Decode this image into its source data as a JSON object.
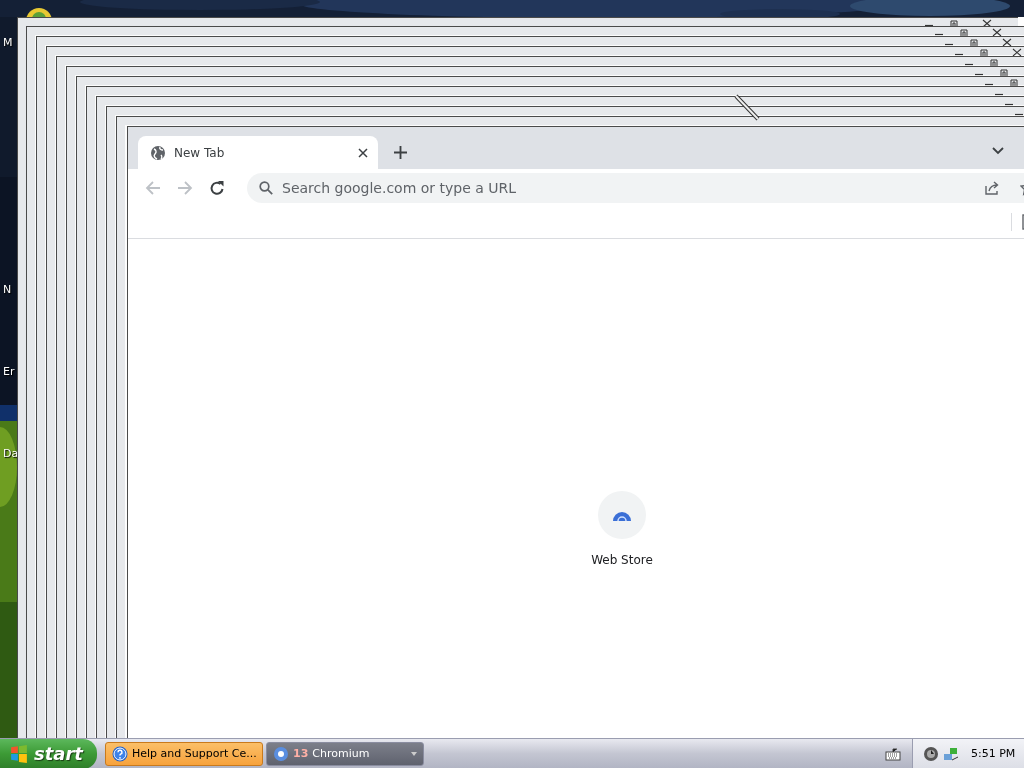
{
  "desktop": {
    "icons": [
      {
        "label": "M"
      },
      {
        "label": "N"
      },
      {
        "label": "Er"
      },
      {
        "label": "Da"
      }
    ]
  },
  "browser": {
    "tabs": [
      {
        "title": "New Tab",
        "selected": true
      }
    ],
    "omnibox": {
      "placeholder": "Search google.com or type a URL"
    },
    "shortcuts": [
      {
        "label": "Web Store"
      }
    ]
  },
  "taskbar": {
    "start": "start",
    "tasks": [
      {
        "kind": "window",
        "label": "Help and Support Ce...",
        "highlighted": true
      },
      {
        "kind": "group",
        "count": "13",
        "label": "Chromium",
        "highlighted": false
      }
    ],
    "clock": "5:51 PM"
  }
}
